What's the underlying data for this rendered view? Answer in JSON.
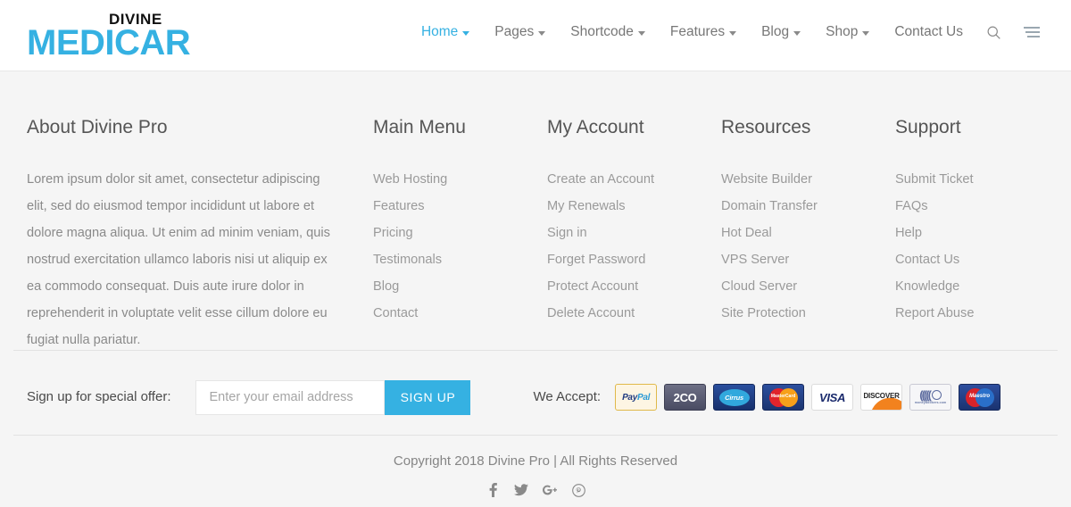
{
  "brand": {
    "top_word": "DIVINE",
    "main_word": "MEDICAR",
    "accent_color": "#35b1e2"
  },
  "header": {
    "nav": [
      {
        "label": "Home",
        "has_caret": true,
        "active": true
      },
      {
        "label": "Pages",
        "has_caret": true,
        "active": false
      },
      {
        "label": "Shortcode",
        "has_caret": true,
        "active": false
      },
      {
        "label": "Features",
        "has_caret": true,
        "active": false
      },
      {
        "label": "Blog",
        "has_caret": true,
        "active": false
      },
      {
        "label": "Shop",
        "has_caret": true,
        "active": false
      },
      {
        "label": "Contact Us",
        "has_caret": false,
        "active": false
      }
    ],
    "search_icon": "search-icon",
    "menu_icon": "hamburger-icon"
  },
  "footer": {
    "about": {
      "title": "About Divine Pro",
      "text": "Lorem ipsum dolor sit amet, consectetur adipiscing elit, sed do eiusmod tempor incididunt ut labore et dolore magna aliqua. Ut enim ad minim veniam, quis nostrud exercitation ullamco laboris nisi ut aliquip ex ea commodo consequat. Duis aute irure dolor in reprehenderit in voluptate velit esse cillum dolore eu fugiat nulla pariatur."
    },
    "columns": [
      {
        "title": "Main Menu",
        "links": [
          "Web Hosting",
          "Features",
          "Pricing",
          "Testimonals",
          "Blog",
          "Contact"
        ]
      },
      {
        "title": "My Account",
        "links": [
          "Create an Account",
          "My Renewals",
          "Sign in",
          "Forget Password",
          "Protect Account",
          "Delete Account"
        ]
      },
      {
        "title": "Resources",
        "links": [
          "Website Builder",
          "Domain Transfer",
          "Hot Deal",
          "VPS Server",
          "Cloud Server",
          "Site Protection"
        ]
      },
      {
        "title": "Support",
        "links": [
          "Submit Ticket",
          "FAQs",
          "Help",
          "Contact Us",
          "Knowledge",
          "Report Abuse"
        ]
      }
    ],
    "signup": {
      "label": "Sign up for special offer:",
      "email_placeholder": "Enter your email address",
      "email_value": "",
      "button_label": "SIGN UP"
    },
    "payments": {
      "label": "We Accept:",
      "cards": [
        {
          "name": "paypal",
          "text": "PayPal"
        },
        {
          "name": "2checkout",
          "text": "2CO"
        },
        {
          "name": "cirrus",
          "text": "Cirrus"
        },
        {
          "name": "mastercard",
          "text": "MasterCard"
        },
        {
          "name": "visa",
          "text": "VISA"
        },
        {
          "name": "discover",
          "text": "DISCOVER"
        },
        {
          "name": "moneybookers",
          "text": "moneybookers.com"
        },
        {
          "name": "maestro",
          "text": "Maestro"
        }
      ]
    },
    "copyright": "Copyright 2018 Divine Pro  |  All Rights Reserved",
    "socials": [
      {
        "name": "facebook-icon",
        "glyph": "f"
      },
      {
        "name": "twitter-icon",
        "glyph": "t"
      },
      {
        "name": "google-plus-icon",
        "glyph": "G+"
      },
      {
        "name": "pinterest-icon",
        "glyph": "p"
      }
    ]
  }
}
